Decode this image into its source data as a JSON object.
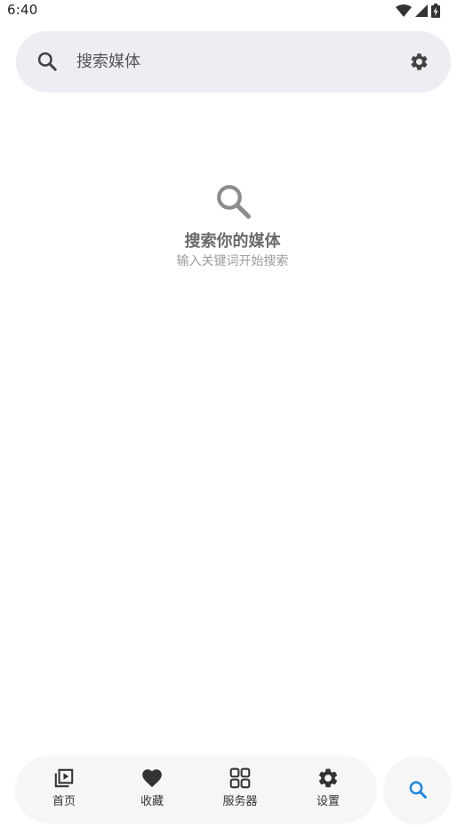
{
  "status_bar": {
    "time": "6:40",
    "icons": [
      "wifi-icon",
      "signal-icon",
      "battery-charging-icon"
    ]
  },
  "search": {
    "placeholder": "搜索媒体",
    "value": "",
    "leading_icon": "search-icon",
    "trailing_icon": "gear-icon"
  },
  "empty_state": {
    "icon": "search-icon",
    "title": "搜索你的媒体",
    "subtitle": "输入关键词开始搜索"
  },
  "bottom_nav": {
    "items": [
      {
        "label": "首页",
        "icon": "video-library-icon"
      },
      {
        "label": "收藏",
        "icon": "heart-icon"
      },
      {
        "label": "服务器",
        "icon": "grid-icon"
      },
      {
        "label": "设置",
        "icon": "gear-icon"
      }
    ],
    "fab_icon": "search-icon"
  },
  "colors": {
    "search_bar_bg": "#efecf4",
    "accent": "#1e88e5",
    "icon_dark": "#444444",
    "empty_icon": "#8c8c8c"
  }
}
